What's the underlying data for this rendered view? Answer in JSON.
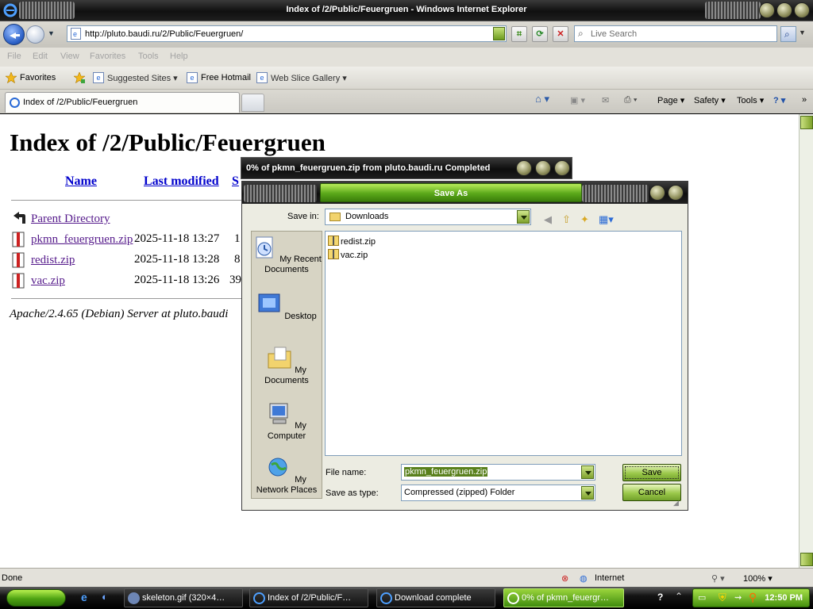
{
  "browser": {
    "window_title": "Index of /2/Public/Feuergruen - Windows Internet Explorer",
    "address": "http://pluto.baudi.ru/2/Public/Feuergruen/",
    "search_placeholder": "Live Search",
    "menu": [
      "File",
      "Edit",
      "View",
      "Favorites",
      "Tools",
      "Help"
    ],
    "favorites_label": "Favorites",
    "favorites_items": [
      "Suggested Sites",
      "Free Hotmail",
      "Web Slice Gallery"
    ],
    "tab_title": "Index of /2/Public/Feuergruen",
    "command_items": [
      "Page",
      "Safety",
      "Tools"
    ],
    "status_text": "Done",
    "zone": "Internet",
    "zoom": "100%"
  },
  "page": {
    "heading": "Index of /2/Public/Feuergruen",
    "columns": [
      "Name",
      "Last modified",
      "S"
    ],
    "parent": "Parent Directory",
    "rows": [
      {
        "name": "pkmn_feuergruen.zip",
        "modified": "2025-11-18 13:27",
        "size": "1"
      },
      {
        "name": "redist.zip",
        "modified": "2025-11-18 13:28",
        "size": "8"
      },
      {
        "name": "vac.zip",
        "modified": "2025-11-18 13:26",
        "size": "39"
      }
    ],
    "footer": "Apache/2.4.65 (Debian) Server at pluto.baudi"
  },
  "download": {
    "title": "0% of pkmn_feuergruen.zip from pluto.baudi.ru Completed"
  },
  "dialog": {
    "title": "Save As",
    "save_in_label": "Save in:",
    "save_in_value": "Downloads",
    "places": [
      "My Recent Documents",
      "Desktop",
      "My Documents",
      "My Computer",
      "My Network Places"
    ],
    "files": [
      "redist.zip",
      "vac.zip"
    ],
    "file_name_label": "File name:",
    "file_name_value": "pkmn_feuergruen.zip",
    "save_type_label": "Save as type:",
    "save_type_value": "Compressed (zipped) Folder",
    "save_button": "Save",
    "cancel_button": "Cancel"
  },
  "taskbar": {
    "items": [
      "skeleton.gif (320×4…",
      "Index of /2/Public/F…",
      "Download complete",
      "0% of pkmn_feuergr…"
    ],
    "active_index": 3,
    "clock": "12:50 PM"
  },
  "colors": {
    "accent_green": "#5aa81a",
    "link": "#0000cc",
    "visited": "#551a8b"
  }
}
